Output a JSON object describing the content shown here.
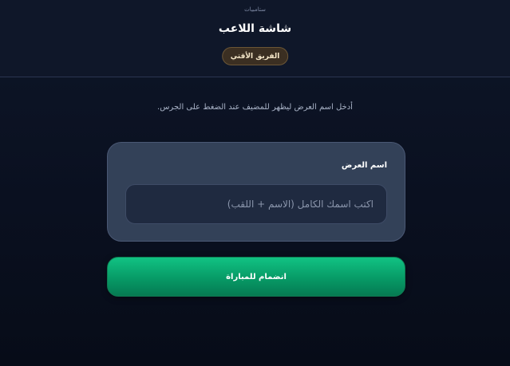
{
  "header": {
    "brand": "ستامبيات",
    "title": "شاشة اللاعب",
    "team_badge": "الفريق الأقتي"
  },
  "main": {
    "instruction": "أدخل اسم العرض ليظهر للمضيف عند الضغط على الجرس.",
    "display_name": {
      "label": "اسم العرض",
      "placeholder": "اكتب اسمك الكامل (الاسم + اللقب)",
      "value": ""
    },
    "join_button_label": "انضمام للمباراة"
  },
  "colors": {
    "background": "#0b1222",
    "card": "#334158",
    "input": "#1f2a40",
    "accent_green": "#079a66",
    "badge": "#3b2f22"
  }
}
